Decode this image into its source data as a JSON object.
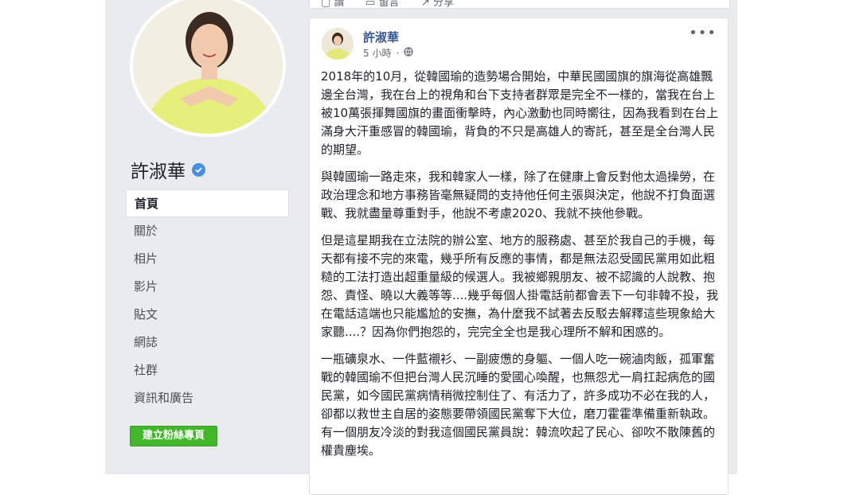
{
  "page": {
    "name": "許淑華",
    "nav": [
      "首頁",
      "關於",
      "相片",
      "影片",
      "貼文",
      "網誌",
      "社群",
      "資訊和廣告"
    ],
    "create_button": "建立粉絲專頁"
  },
  "top_actions": [
    "讚",
    "留言",
    "分享"
  ],
  "post": {
    "author": "許淑華",
    "time": "5 小時",
    "paragraphs": [
      "2018年的10月，從韓國瑜的造勢場合開始，中華民國國旗的旗海從高雄飄邊全台灣，我在台上的視角和台下支持者群眾是完全不一樣的，當我在台上被10萬張揮舞國旗的畫面衝擊時，內心激動也同時嚮往，因為我看到在台上滿身大汗重感冒的韓國瑜，背負的不只是高雄人的寄託，甚至是全台灣人民的期望。",
      "與韓國瑜一路走來，我和韓家人一樣，除了在健康上會反對他太過操勞，在政治理念和地方事務皆毫無疑問的支持他任何主張與決定，他說不打負面選戰、我就盡量尊重對手，他說不考慮2020、我就不挾他參戰。",
      "但是這星期我在立法院的辦公室、地方的服務處、甚至於我自己的手機，每天都有接不完的來電，幾乎所有反應的事情，都是無法忍受國民黨用如此粗糙的工法打造出超重量級的候選人。我被鄉親朋友、被不認識的人說教、抱怨、責怪、曉以大義等等....幾乎每個人掛電話前都會丟下一句非韓不投，我在電話這端也只能尷尬的安撫，為什麼我不試著去反駁去解釋這些現象給大家聽....？因為你們抱怨的，完完全全也是我心理所不解和困惑的。",
      "一瓶礦泉水、一件藍襯衫、一副疲憊的身軀、一個人吃一碗滷肉飯，孤軍奮戰的韓國瑜不但把台灣人民沉睡的愛國心喚醒，也無怨尤一肩扛起病危的國民黨，如今國民黨病情稍微控制住了、有活力了，許多成功不必在我的人，卻都以救世主自居的姿態要帶領國民黨奪下大位，磨刀霍霍準備重新執政。有一個朋友冷淡的對我這個國民黨員說：韓流吹起了民心、卻吹不散陳舊的權貴塵埃。"
    ]
  },
  "colors": {
    "link": "#385898",
    "verified": "#4a90e2",
    "create_button": "#42b72a",
    "background": "#e9ebee"
  },
  "icons": [
    "verified-badge-icon",
    "globe-icon",
    "more-options-icon",
    "like-icon",
    "comment-icon",
    "share-icon"
  ]
}
